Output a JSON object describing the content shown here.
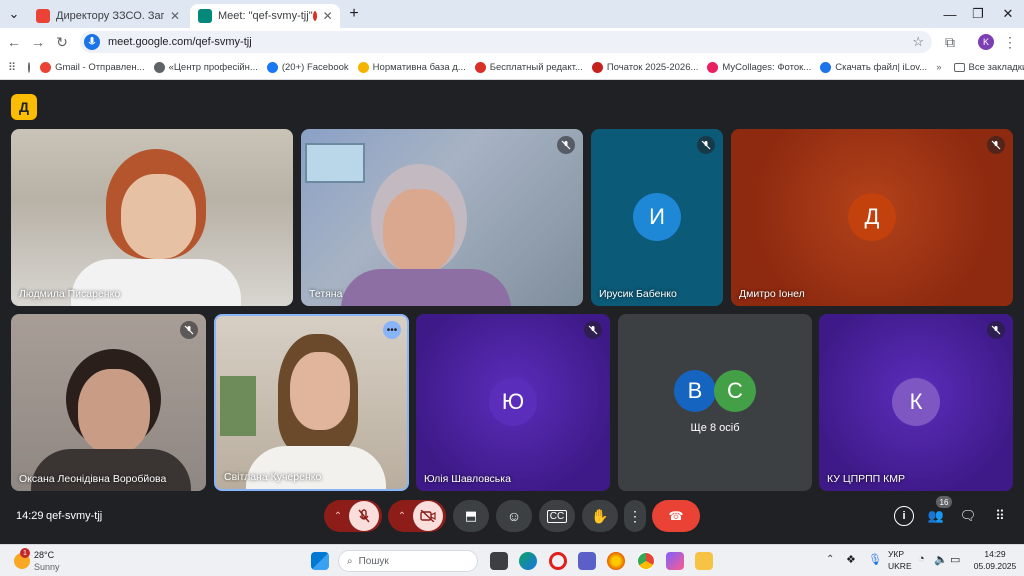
{
  "browser": {
    "tabs": [
      {
        "label": "Директору ЗЗСО. Запрошення",
        "active": false
      },
      {
        "label": "Meet: \"qef-svmy-tjj\"",
        "active": true
      }
    ],
    "new_tab": "+",
    "url": "meet.google.com/qef-svmy-tjj",
    "profile_initial": "K",
    "bookmarks": [
      {
        "label": "Gmail - Отправлен...",
        "color": "#ea4335"
      },
      {
        "label": "«Центр професійн...",
        "color": "#5f6368"
      },
      {
        "label": "(20+) Facebook",
        "color": "#1877f2"
      },
      {
        "label": "Нормативна база д...",
        "color": "#f4b400"
      },
      {
        "label": "Бесплатный редакт...",
        "color": "#d93025"
      },
      {
        "label": "Початок 2025-2026...",
        "color": "#c5221f"
      },
      {
        "label": "MyCollages: Фоток...",
        "color": "#e91e63"
      },
      {
        "label": "Скачать файл| iLov...",
        "color": "#1a73e8"
      }
    ],
    "all_bookmarks": "Все закладки"
  },
  "meet": {
    "participants": [
      {
        "name": "Людмила Писаренко",
        "type": "video",
        "muted": false
      },
      {
        "name": "Тетяна",
        "type": "video",
        "muted": true
      },
      {
        "name": "Ирусик Бабенко",
        "type": "avatar",
        "initial": "И",
        "muted": true,
        "bg": "#0b5a78",
        "avatar_color": "#1e88d6"
      },
      {
        "name": "Дмитро Іонел",
        "type": "avatar",
        "initial": "Д",
        "muted": true,
        "bg": "#8e2a10",
        "avatar_color": "#c2410c"
      },
      {
        "name": "Оксана Леонідівна Воробйова",
        "type": "video",
        "muted": true
      },
      {
        "name": "Світлана Кучеренко",
        "type": "video",
        "muted": false
      },
      {
        "name": "Юлія Шавловська",
        "type": "avatar",
        "initial": "Ю",
        "muted": true,
        "bg": "#4a1f9e",
        "avatar_color": "#5b2dbb"
      },
      {
        "name": "КУ ЦПРПП КМР",
        "type": "avatar",
        "initial": "К",
        "muted": true,
        "bg": "#4a1f9e",
        "avatar_color": "#7e57c2"
      }
    ],
    "others": {
      "label": "Ще 8 осіб",
      "initials": [
        "В",
        "С"
      ],
      "colors": [
        "#1565c0",
        "#43a047"
      ]
    },
    "time": "14:29",
    "meeting_code": "qef-svmy-tjj",
    "participant_count": "16"
  },
  "taskbar": {
    "weather_temp": "28°C",
    "weather_desc": "Sunny",
    "weather_badge": "1",
    "search_placeholder": "Пошук",
    "lang_top": "УКР",
    "lang_bottom": "UKRE",
    "clock_time": "14:29",
    "clock_date": "05.09.2025"
  }
}
